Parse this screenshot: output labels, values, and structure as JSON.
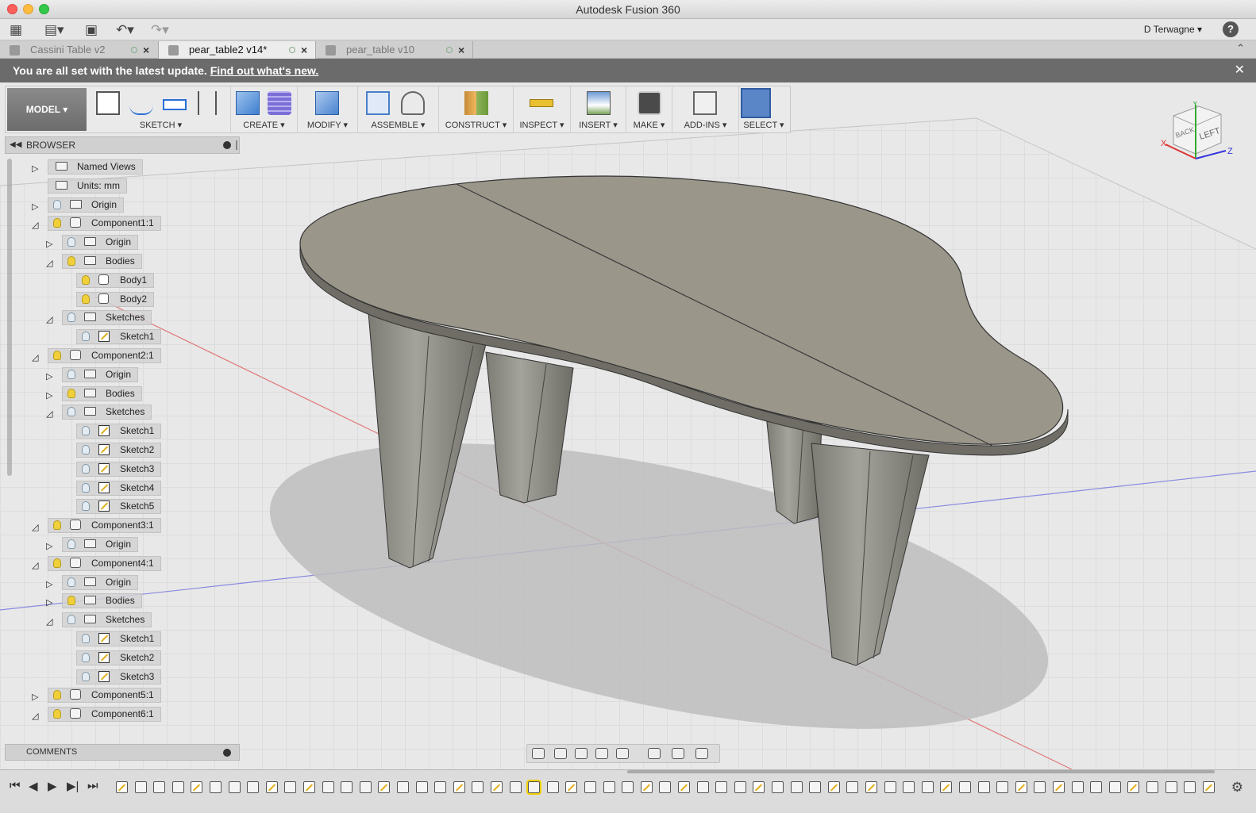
{
  "window": {
    "title": "Autodesk Fusion 360"
  },
  "quickbar": {
    "user": "D Terwagne ▾",
    "help": "?"
  },
  "tabs": [
    {
      "label": "Cassini Table v2",
      "active": false
    },
    {
      "label": "pear_table2 v14*",
      "active": true
    },
    {
      "label": "pear_table v10",
      "active": false
    }
  ],
  "banner": {
    "text": "You are all set with the latest update.",
    "link": "Find out what's new."
  },
  "ribbon": {
    "model": "MODEL ▾",
    "groups": [
      {
        "label": "SKETCH ▾"
      },
      {
        "label": "CREATE ▾"
      },
      {
        "label": "MODIFY ▾"
      },
      {
        "label": "ASSEMBLE ▾"
      },
      {
        "label": "CONSTRUCT ▾"
      },
      {
        "label": "INSPECT ▾"
      },
      {
        "label": "INSERT ▾"
      },
      {
        "label": "MAKE ▾"
      },
      {
        "label": "ADD-INS ▾"
      },
      {
        "label": "SELECT ▾"
      }
    ]
  },
  "browser": {
    "title": "BROWSER",
    "nodes": [
      {
        "label": "Named Views",
        "level": 0,
        "expand": "closed",
        "bulb": "none",
        "icon": "folder"
      },
      {
        "label": "Units: mm",
        "level": 0,
        "expand": "none",
        "bulb": "none",
        "icon": "folder"
      },
      {
        "label": "Origin",
        "level": 0,
        "expand": "closed",
        "bulb": "off",
        "icon": "folder"
      },
      {
        "label": "Component1:1",
        "level": 0,
        "expand": "open",
        "bulb": "on",
        "icon": "comp"
      },
      {
        "label": "Origin",
        "level": 1,
        "expand": "closed",
        "bulb": "off",
        "icon": "folder"
      },
      {
        "label": "Bodies",
        "level": 1,
        "expand": "open",
        "bulb": "on",
        "icon": "folder"
      },
      {
        "label": "Body1",
        "level": 2,
        "expand": "none",
        "bulb": "on",
        "icon": "body"
      },
      {
        "label": "Body2",
        "level": 2,
        "expand": "none",
        "bulb": "on",
        "icon": "body"
      },
      {
        "label": "Sketches",
        "level": 1,
        "expand": "open",
        "bulb": "off",
        "icon": "folder"
      },
      {
        "label": "Sketch1",
        "level": 2,
        "expand": "none",
        "bulb": "off",
        "icon": "sketch"
      },
      {
        "label": "Component2:1",
        "level": 0,
        "expand": "open",
        "bulb": "on",
        "icon": "comp"
      },
      {
        "label": "Origin",
        "level": 1,
        "expand": "closed",
        "bulb": "off",
        "icon": "folder"
      },
      {
        "label": "Bodies",
        "level": 1,
        "expand": "closed",
        "bulb": "on",
        "icon": "folder"
      },
      {
        "label": "Sketches",
        "level": 1,
        "expand": "open",
        "bulb": "off",
        "icon": "folder"
      },
      {
        "label": "Sketch1",
        "level": 2,
        "expand": "none",
        "bulb": "off",
        "icon": "sketch"
      },
      {
        "label": "Sketch2",
        "level": 2,
        "expand": "none",
        "bulb": "off",
        "icon": "sketch"
      },
      {
        "label": "Sketch3",
        "level": 2,
        "expand": "none",
        "bulb": "off",
        "icon": "sketch"
      },
      {
        "label": "Sketch4",
        "level": 2,
        "expand": "none",
        "bulb": "off",
        "icon": "sketch"
      },
      {
        "label": "Sketch5",
        "level": 2,
        "expand": "none",
        "bulb": "off",
        "icon": "sketch"
      },
      {
        "label": "Component3:1",
        "level": 0,
        "expand": "open",
        "bulb": "on",
        "icon": "comp"
      },
      {
        "label": "Origin",
        "level": 1,
        "expand": "closed",
        "bulb": "off",
        "icon": "folder"
      },
      {
        "label": "Component4:1",
        "level": 0,
        "expand": "open",
        "bulb": "on",
        "icon": "comp"
      },
      {
        "label": "Origin",
        "level": 1,
        "expand": "closed",
        "bulb": "off",
        "icon": "folder"
      },
      {
        "label": "Bodies",
        "level": 1,
        "expand": "closed",
        "bulb": "on",
        "icon": "folder"
      },
      {
        "label": "Sketches",
        "level": 1,
        "expand": "open",
        "bulb": "off",
        "icon": "folder"
      },
      {
        "label": "Sketch1",
        "level": 2,
        "expand": "none",
        "bulb": "off",
        "icon": "sketch"
      },
      {
        "label": "Sketch2",
        "level": 2,
        "expand": "none",
        "bulb": "off",
        "icon": "sketch"
      },
      {
        "label": "Sketch3",
        "level": 2,
        "expand": "none",
        "bulb": "off",
        "icon": "sketch"
      },
      {
        "label": "Component5:1",
        "level": 0,
        "expand": "closed",
        "bulb": "on",
        "icon": "comp"
      },
      {
        "label": "Component6:1",
        "level": 0,
        "expand": "open",
        "bulb": "on",
        "icon": "comp"
      }
    ]
  },
  "comments": {
    "title": "COMMENTS"
  },
  "viewcube": {
    "back": "BACK",
    "left": "LEFT",
    "x": "X",
    "y": "Y",
    "z": "Z"
  },
  "colors": {
    "tabletop": "#9a968a",
    "legs": "#8e8c84",
    "shadow": "#bdbdbd",
    "select_accent": "#3b78d8",
    "bulb_on": "#f0d03a"
  }
}
